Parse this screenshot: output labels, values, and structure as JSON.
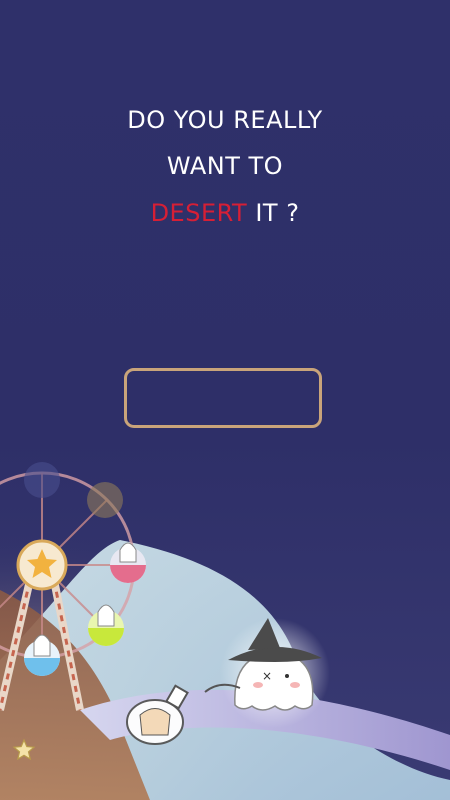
{
  "prompt": {
    "line1": "DO YOU REALLY",
    "line2": "WANT TO",
    "line3_highlight": "DESERT",
    "line3_rest": " IT ?"
  },
  "answer_input": {
    "value": "",
    "placeholder": ""
  },
  "colors": {
    "background": "#2f306a",
    "text": "#ffffff",
    "highlight": "#d61f35",
    "input_border": "#c9a47a"
  },
  "icons": {
    "star": "star-icon"
  }
}
